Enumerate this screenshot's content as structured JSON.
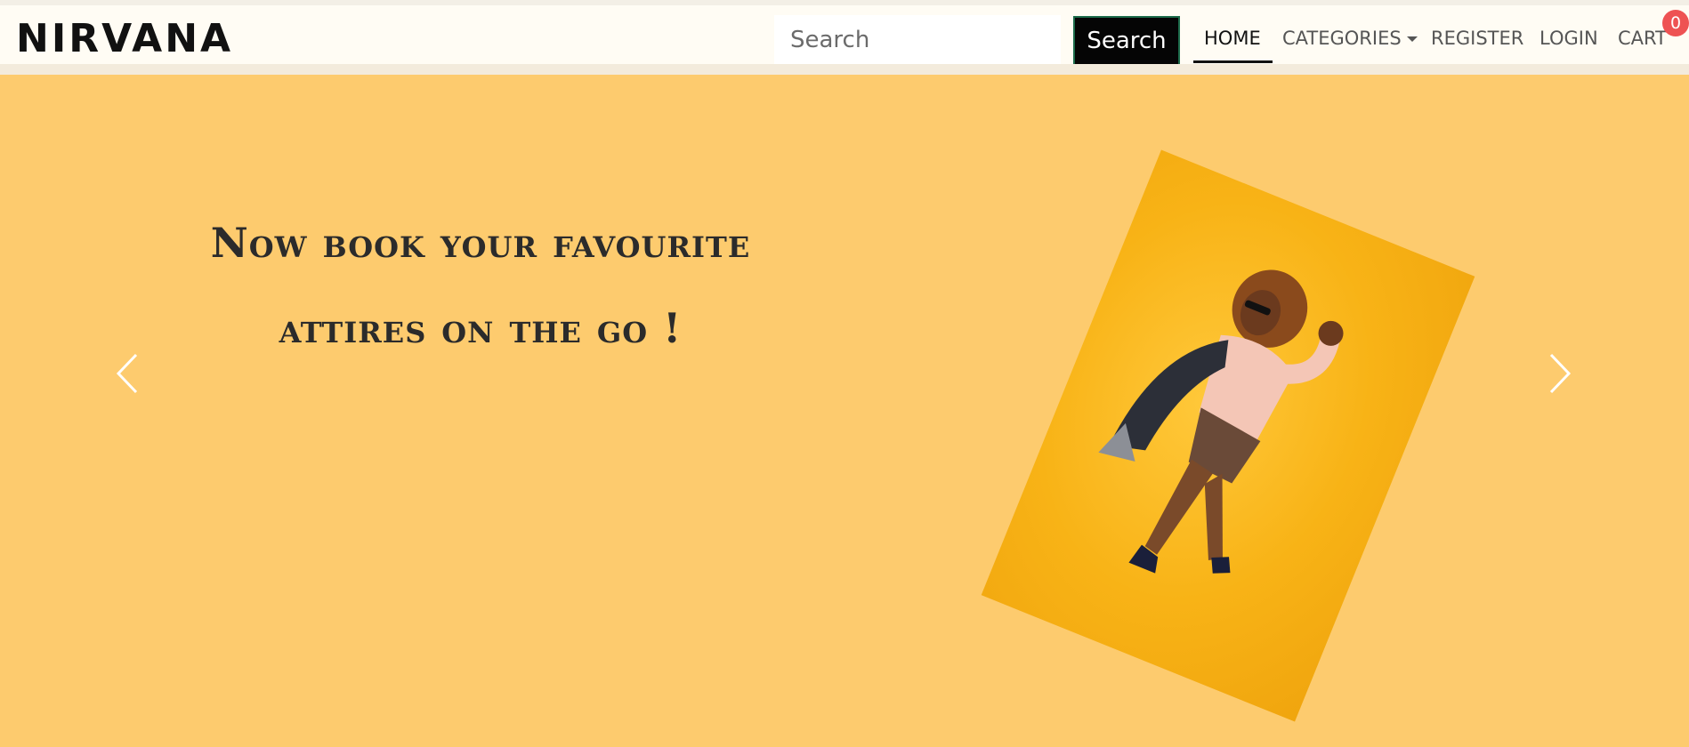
{
  "brand": {
    "name": "NIRVANA"
  },
  "search": {
    "placeholder": "Search",
    "button_label": "Search"
  },
  "nav": {
    "home": "HOME",
    "categories": "CATEGORIES",
    "register": "REGISTER",
    "login": "LOGIN",
    "cart": "CART",
    "cart_count": "0"
  },
  "hero": {
    "line1": "Now book your favourite",
    "line2": "attires on the go !"
  },
  "carousel": {
    "prev_icon": "chevron-left-icon",
    "next_icon": "chevron-right-icon"
  },
  "colors": {
    "hero_background": "#fdcb6e",
    "navbar_background": "#fffcf4",
    "badge": "#ee5253",
    "search_button": "#050505"
  }
}
